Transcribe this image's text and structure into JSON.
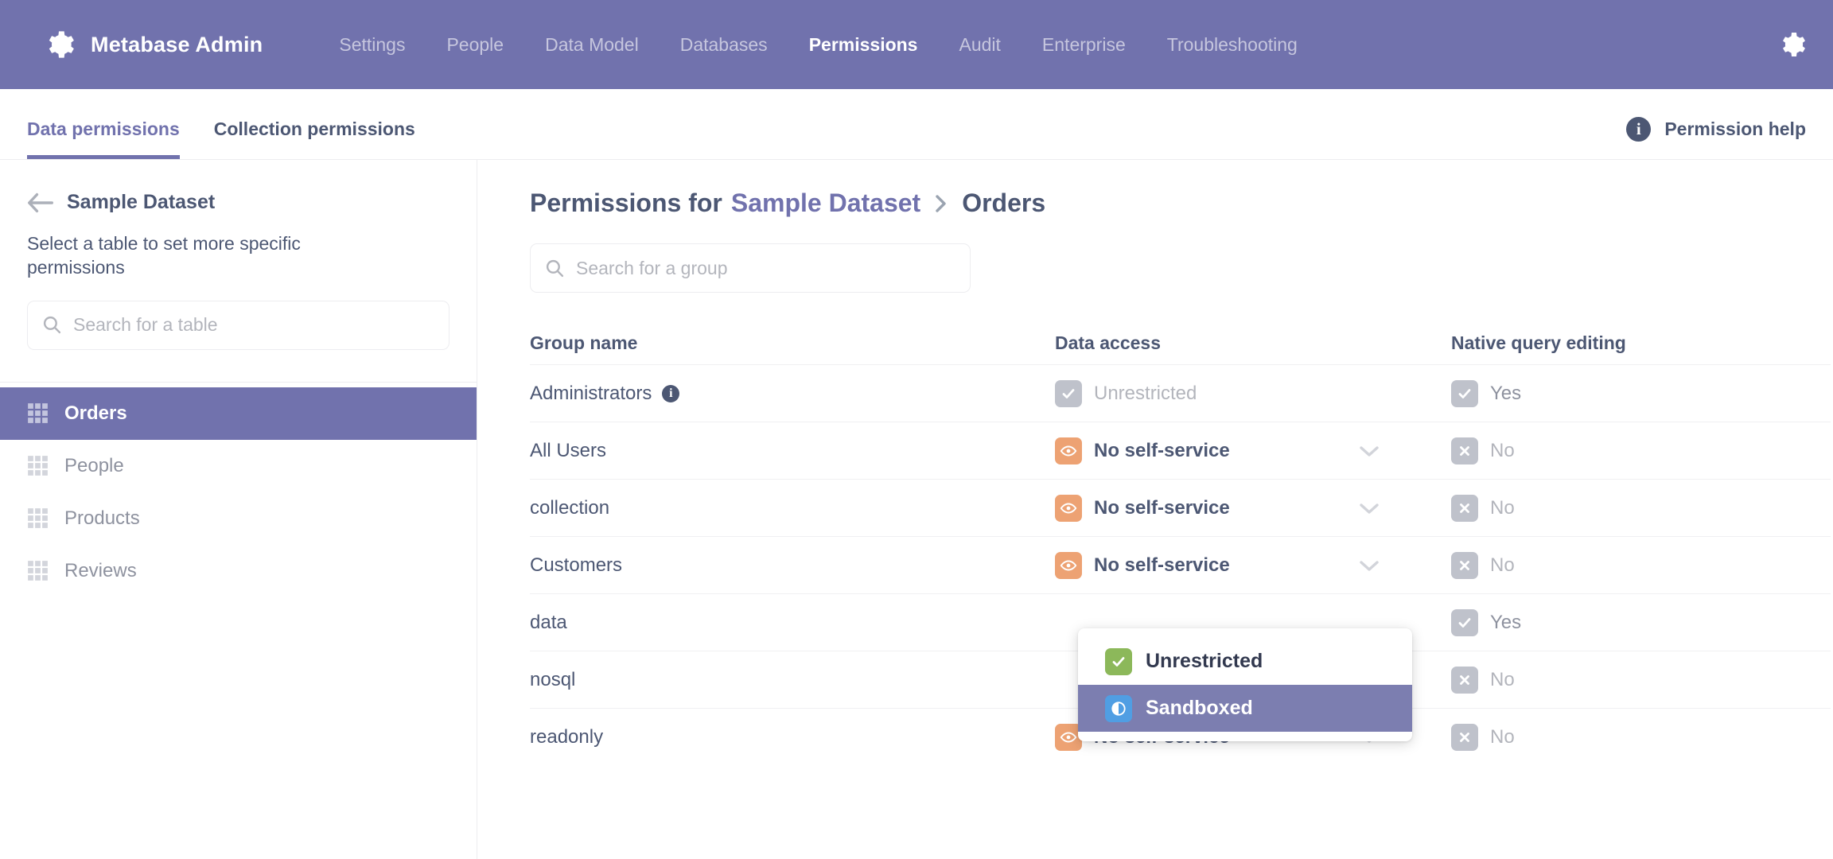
{
  "topnav": {
    "brand": "Metabase Admin",
    "brand_icon": "gear-icon",
    "settings_icon": "gear-icon",
    "accent": "#7172AD",
    "links": [
      {
        "label": "Settings",
        "active": false
      },
      {
        "label": "People",
        "active": false
      },
      {
        "label": "Data Model",
        "active": false
      },
      {
        "label": "Databases",
        "active": false
      },
      {
        "label": "Permissions",
        "active": true
      },
      {
        "label": "Audit",
        "active": false
      },
      {
        "label": "Enterprise",
        "active": false
      },
      {
        "label": "Troubleshooting",
        "active": false
      }
    ]
  },
  "tabbar": {
    "tabs": [
      {
        "label": "Data permissions",
        "active": true
      },
      {
        "label": "Collection permissions",
        "active": false
      }
    ],
    "help": {
      "label": "Permission help",
      "icon": "info-icon"
    }
  },
  "sidebar": {
    "back_icon": "arrow-left-icon",
    "database": "Sample Dataset",
    "description": "Select a table to set more specific permissions",
    "search": {
      "placeholder": "Search for a table",
      "value": "",
      "icon": "search-icon"
    },
    "tables": [
      {
        "label": "Orders",
        "icon": "table-grid-icon",
        "selected": true
      },
      {
        "label": "People",
        "icon": "table-grid-icon",
        "selected": false
      },
      {
        "label": "Products",
        "icon": "table-grid-icon",
        "selected": false
      },
      {
        "label": "Reviews",
        "icon": "table-grid-icon",
        "selected": false
      }
    ]
  },
  "main": {
    "title_prefix": "Permissions for",
    "title_database": "Sample Dataset",
    "title_separator": "chevron-right-icon",
    "title_table": "Orders",
    "group_search": {
      "placeholder": "Search for a group",
      "value": "",
      "icon": "search-icon"
    },
    "columns": {
      "group_name": "Group name",
      "data_access": "Data access",
      "native_query": "Native query editing"
    },
    "rows": [
      {
        "group": "Administrators",
        "has_info": true,
        "access": {
          "label": "Unrestricted",
          "icon": "check-icon",
          "color": "grey",
          "muted": true,
          "has_chevron": false
        },
        "native": {
          "label": "Yes",
          "icon": "check-icon",
          "color": "grey",
          "muted": true
        }
      },
      {
        "group": "All Users",
        "has_info": false,
        "access": {
          "label": "No self-service",
          "icon": "eye-icon",
          "color": "orange",
          "muted": false,
          "has_chevron": true
        },
        "native": {
          "label": "No",
          "icon": "x-icon",
          "color": "grey",
          "muted": true
        }
      },
      {
        "group": "collection",
        "has_info": false,
        "access": {
          "label": "No self-service",
          "icon": "eye-icon",
          "color": "orange",
          "muted": false,
          "has_chevron": true
        },
        "native": {
          "label": "No",
          "icon": "x-icon",
          "color": "grey",
          "muted": true
        }
      },
      {
        "group": "Customers",
        "has_info": false,
        "access": {
          "label": "No self-service",
          "icon": "eye-icon",
          "color": "orange",
          "muted": false,
          "has_chevron": true
        },
        "native": {
          "label": "No",
          "icon": "x-icon",
          "color": "grey",
          "muted": true
        }
      },
      {
        "group": "data",
        "has_info": false,
        "access": {
          "label": "",
          "icon": "",
          "color": "",
          "muted": false,
          "has_chevron": false
        },
        "native": {
          "label": "Yes",
          "icon": "check-icon",
          "color": "grey",
          "muted": true
        }
      },
      {
        "group": "nosql",
        "has_info": false,
        "access": {
          "label": "",
          "icon": "",
          "color": "",
          "muted": false,
          "has_chevron": false
        },
        "native": {
          "label": "No",
          "icon": "x-icon",
          "color": "grey",
          "muted": true
        }
      },
      {
        "group": "readonly",
        "has_info": false,
        "access": {
          "label": "No self-service",
          "icon": "eye-icon",
          "color": "orange",
          "muted": false,
          "has_chevron": true
        },
        "native": {
          "label": "No",
          "icon": "x-icon",
          "color": "grey",
          "muted": true
        }
      }
    ]
  },
  "dropdown": {
    "open": true,
    "items": [
      {
        "label": "Unrestricted",
        "icon": "check-icon",
        "color": "green",
        "highlighted": false
      },
      {
        "label": "Sandboxed",
        "icon": "half-circle-icon",
        "color": "blue",
        "highlighted": true
      }
    ]
  }
}
